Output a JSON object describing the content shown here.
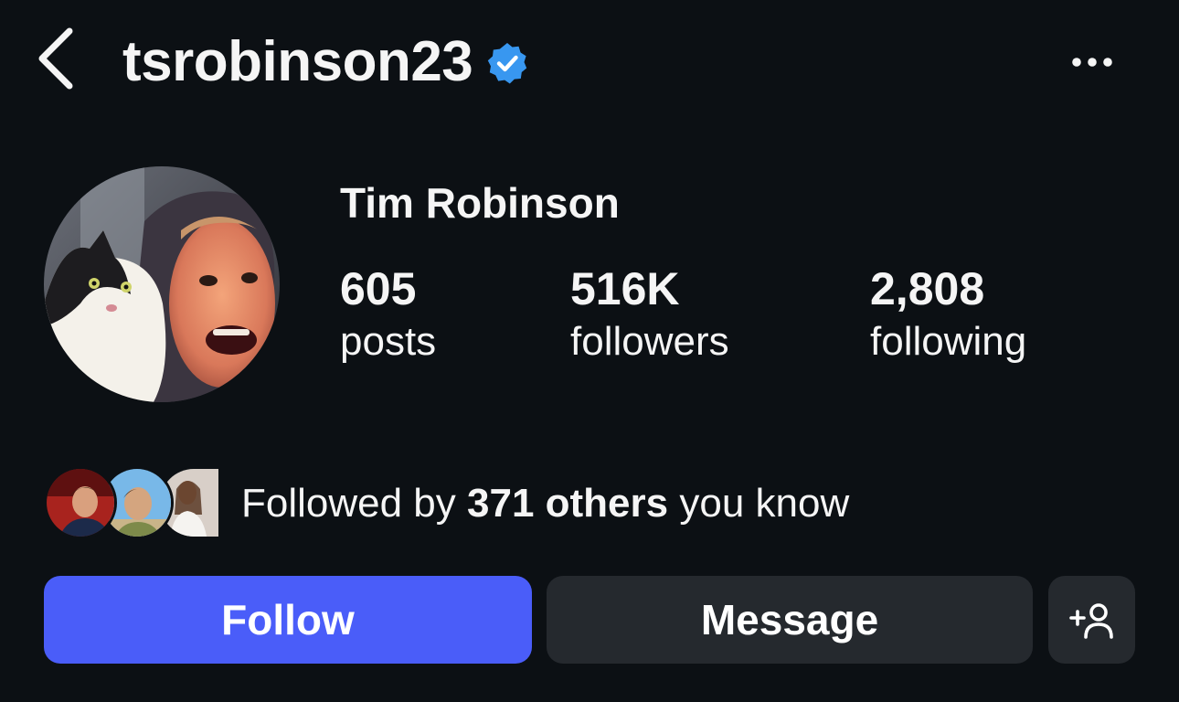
{
  "header": {
    "username": "tsrobinson23",
    "icons": {
      "back": "chevron-left-icon",
      "verified": "verified-badge-icon",
      "more": "more-horizontal-icon"
    },
    "verified_color": "#3897f0"
  },
  "profile": {
    "display_name": "Tim Robinson",
    "stats": [
      {
        "value": "605",
        "label": "posts"
      },
      {
        "value": "516K",
        "label": "followers"
      },
      {
        "value": "2,808",
        "label": "following"
      }
    ]
  },
  "followed_by": {
    "prefix": "Followed by",
    "count_text": "371 others",
    "suffix": "you know"
  },
  "actions": {
    "follow_label": "Follow",
    "message_label": "Message",
    "suggest_icon": "add-person-icon"
  },
  "colors": {
    "background": "#0c1014",
    "follow_button": "#4a5df9",
    "secondary_button": "#25292e",
    "text": "#f5f5f5"
  }
}
